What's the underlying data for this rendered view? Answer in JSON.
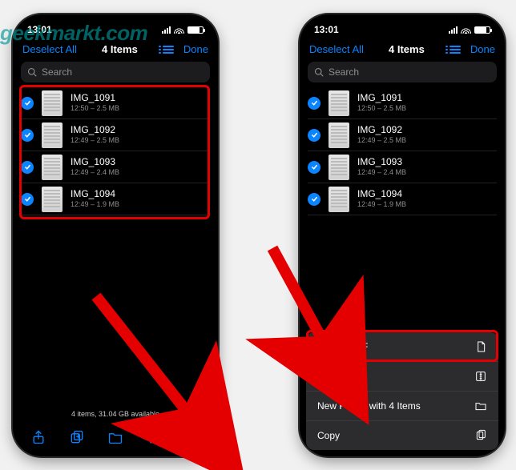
{
  "watermark": "geekmarkt.com",
  "status": {
    "time": "13:01"
  },
  "nav": {
    "deselect": "Deselect All",
    "title": "4 Items",
    "done": "Done"
  },
  "search": {
    "placeholder": "Search"
  },
  "files": [
    {
      "name": "IMG_1091",
      "sub": "12:50 – 2.5 MB"
    },
    {
      "name": "IMG_1092",
      "sub": "12:49 – 2.5 MB"
    },
    {
      "name": "IMG_1093",
      "sub": "12:49 – 2.4 MB"
    },
    {
      "name": "IMG_1094",
      "sub": "12:49 – 1.9 MB"
    }
  ],
  "footer": {
    "status": "4 items, 31.04 GB available"
  },
  "sheet": {
    "create_pdf": "Create PDF",
    "compress": "Compress",
    "new_folder": "New Folder with 4 Items",
    "copy": "Copy"
  }
}
